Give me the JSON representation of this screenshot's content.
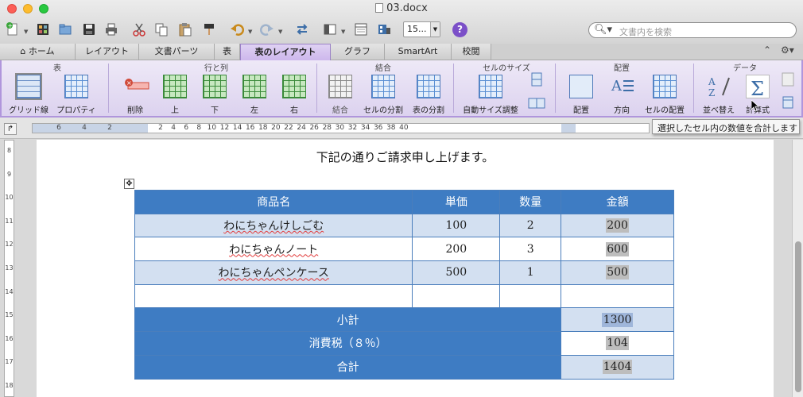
{
  "window": {
    "title": "03.docx"
  },
  "toolbar": {
    "zoom_value": "15...",
    "search_placeholder": "文書内を検索",
    "icons": [
      "new-document-icon",
      "gallery-icon",
      "open-icon",
      "save-icon",
      "print-icon",
      "cut-icon",
      "copy-icon",
      "paste-icon",
      "format-painter-icon",
      "undo-icon",
      "redo-icon",
      "table-insert-icon",
      "sidebar-icon",
      "toolbox-icon",
      "media-icon",
      "help-icon"
    ]
  },
  "tabs": [
    "ホーム",
    "レイアウト",
    "文書パーツ",
    "表",
    "表のレイアウト",
    "グラフ",
    "SmartArt",
    "校閲"
  ],
  "active_tab": "表のレイアウト",
  "ribbon": {
    "groups": {
      "table": "表",
      "rows_cols": "行と列",
      "merge": "結合",
      "cell_size": "セルのサイズ",
      "alignment": "配置",
      "data": "データ"
    },
    "buttons": {
      "gridlines": "グリッド線",
      "properties": "プロパティ",
      "delete": "削除",
      "above": "上",
      "below": "下",
      "left": "左",
      "right": "右",
      "merge": "結合",
      "split_cells": "セルの分割",
      "split_table": "表の分割",
      "autofit": "自動サイズ調整",
      "align": "配置",
      "direction": "方向",
      "cell_align": "セルの配置",
      "sort": "並べ替え",
      "formula": "計算式"
    }
  },
  "tooltip": "選択したセル内の数値を合計します",
  "ruler": {
    "ticks_left": [
      "6",
      "4",
      "2"
    ],
    "ticks_right": [
      "2",
      "4",
      "6",
      "8",
      "10",
      "12",
      "14",
      "16",
      "18",
      "20",
      "22",
      "24",
      "26",
      "28",
      "30",
      "32",
      "34",
      "36",
      "38",
      "40"
    ],
    "vertical_ticks": [
      "8",
      "9",
      "10",
      "11",
      "12",
      "13",
      "14",
      "15",
      "16",
      "17",
      "18"
    ]
  },
  "document": {
    "intro": "下記の通りご請求申し上げます。",
    "table": {
      "headers": [
        "商品名",
        "単価",
        "数量",
        "金額"
      ],
      "rows": [
        [
          "わにちゃんけしごむ",
          "100",
          "2",
          "200"
        ],
        [
          "わにちゃんノート",
          "200",
          "3",
          "600"
        ],
        [
          "わにちゃんペンケース",
          "500",
          "1",
          "500"
        ],
        [
          "",
          "",
          "",
          ""
        ]
      ],
      "subtotal_label": "小計",
      "subtotal_value": "1300",
      "tax_label": "消費税（８％）",
      "tax_value": "104",
      "total_label": "合計",
      "total_value": "1404"
    }
  },
  "colors": {
    "table_header": "#3e7cc3",
    "table_band": "#d3e0f1",
    "ribbon_accent": "#b096dc"
  }
}
